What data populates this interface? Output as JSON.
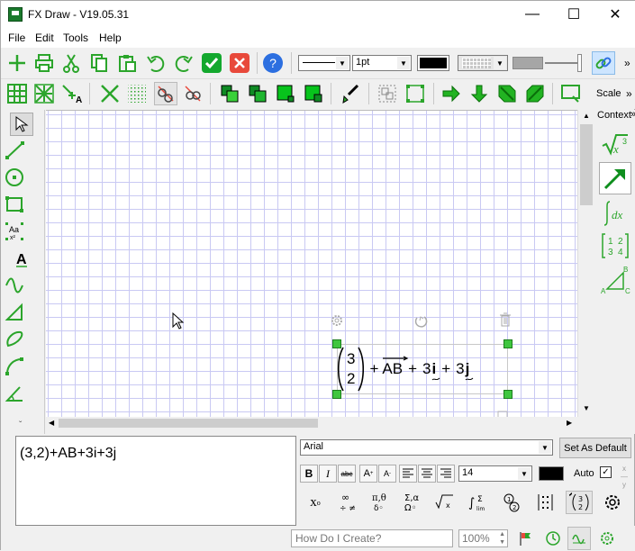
{
  "window": {
    "title": "FX Draw - V19.05.31",
    "minimize": "—",
    "maximize": "☐",
    "close": "✕"
  },
  "menu": [
    "File",
    "Edit",
    "Tools",
    "Help"
  ],
  "toolbar": {
    "line_width": "1pt",
    "more": "»"
  },
  "toolbar2": {
    "scale_label": "Scale",
    "more": "»"
  },
  "right_panel": {
    "context_label": "Context",
    "sqrt_label": "√x³",
    "dx_label": "∫dx",
    "matrix": [
      "1",
      "2",
      "3",
      "4"
    ],
    "abc": [
      "A",
      "B",
      "C"
    ]
  },
  "canvas": {
    "expr": {
      "col_top": "3",
      "col_bottom": "2",
      "plus1": "+",
      "vec_ab": "AB",
      "plus2": "+",
      "term_i": "3",
      "i": "i",
      "plus3": "+",
      "term_j": "3",
      "j": "j"
    }
  },
  "editor": {
    "text": "(3,2)+AB+3i+3j",
    "font": "Arial",
    "font_size": "14",
    "set_default": "Set As Default",
    "auto_label": "Auto",
    "bold": "B",
    "italic": "I",
    "strike": "abc"
  },
  "status": {
    "how_do_i": "How Do I Create?",
    "zoom": "100%"
  },
  "colors": {
    "green": "#2ba52b",
    "accent_green": "#00b700",
    "grid": "#c9c9f3"
  }
}
